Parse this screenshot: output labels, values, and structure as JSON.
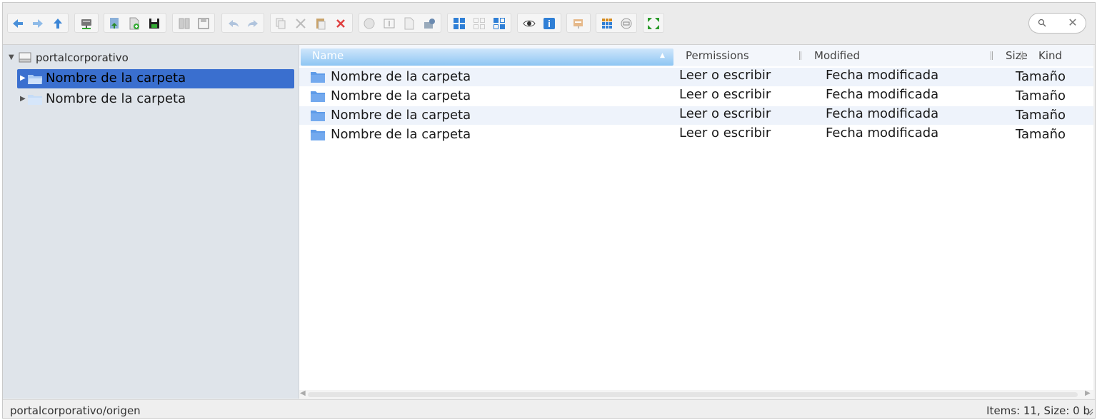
{
  "toolbar": {
    "groups": [
      [
        "back-icon",
        "forward-icon",
        "up-icon"
      ],
      [
        "network-drive-icon"
      ],
      [
        "download-icon",
        "new-file-icon",
        "save-icon"
      ],
      [
        "columns-icon",
        "floppy-icon"
      ],
      [
        "undo-icon",
        "redo-icon"
      ],
      [
        "copy-icon",
        "cut-icon",
        "paste-icon",
        "delete-icon"
      ],
      [
        "duplicate-icon",
        "rename-icon",
        "edit-file-icon",
        "extract-icon"
      ],
      [
        "icons-view-icon",
        "grid-view-icon",
        "list-view-icon"
      ],
      [
        "preview-icon",
        "info-icon"
      ],
      [
        "archive-icon"
      ],
      [
        "sort-icon",
        "resize-icon"
      ],
      [
        "fullscreen-icon"
      ]
    ]
  },
  "search": {
    "value": "",
    "placeholder": "",
    "clear_glyph": "✕"
  },
  "tree": {
    "root": {
      "label": "portalcorporativo"
    },
    "items": [
      {
        "label": "Nombre de la carpeta",
        "selected": true
      },
      {
        "label": "Nombre de la carpeta",
        "selected": false
      }
    ]
  },
  "list": {
    "columns": {
      "name": "Name",
      "permissions": "Permissions",
      "modified": "Modified",
      "size": "Size",
      "kind": "Kind"
    },
    "rows": [
      {
        "name": "Nombre de la carpeta",
        "permissions": "Leer o escribir",
        "modified": "Fecha modificada",
        "size": "Tamaño"
      },
      {
        "name": "Nombre de la carpeta",
        "permissions": "Leer o escribir",
        "modified": "Fecha modificada",
        "size": "Tamaño"
      },
      {
        "name": "Nombre de la carpeta",
        "permissions": "Leer o escribir",
        "modified": "Fecha modificada",
        "size": "Tamaño"
      },
      {
        "name": "Nombre de la carpeta",
        "permissions": "Leer o escribir",
        "modified": "Fecha modificada",
        "size": "Tamaño"
      }
    ]
  },
  "statusbar": {
    "path": "portalcorporativo/origen",
    "info": "Items: 11, Size: 0 b"
  },
  "colors": {
    "selection": "#3a6fcf",
    "header_active": "#8ec6f3",
    "folder": "#5e9be8",
    "tree_bg": "#dfe4ea"
  }
}
